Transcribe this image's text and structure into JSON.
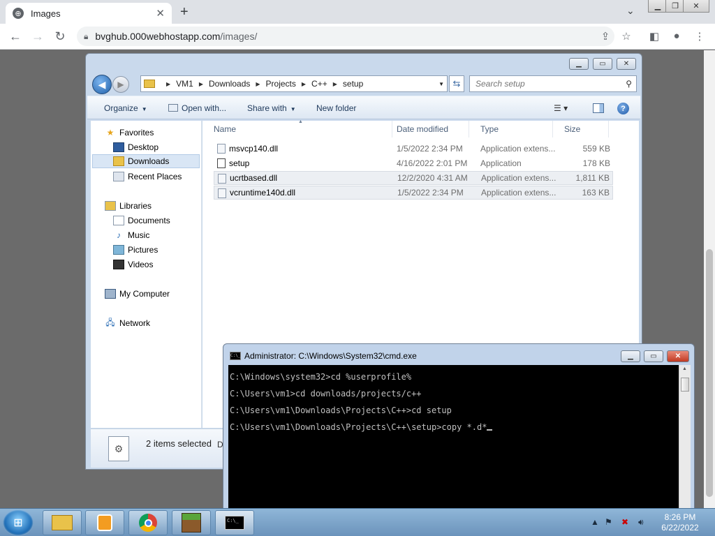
{
  "browser": {
    "tab_title": "Images",
    "url_host": "bvghub.000webhostapp.com",
    "url_path": "/images/"
  },
  "explorer": {
    "breadcrumbs": [
      "VM1",
      "Downloads",
      "Projects",
      "C++",
      "setup"
    ],
    "search_placeholder": "Search setup",
    "commands": {
      "organize": "Organize",
      "open_with": "Open with...",
      "share_with": "Share with",
      "new_folder": "New folder"
    },
    "nav": {
      "favorites": "Favorites",
      "desktop": "Desktop",
      "downloads": "Downloads",
      "recent_places": "Recent Places",
      "libraries": "Libraries",
      "documents": "Documents",
      "music": "Music",
      "pictures": "Pictures",
      "videos": "Videos",
      "my_computer": "My Computer",
      "network": "Network"
    },
    "columns": {
      "name": "Name",
      "date": "Date modified",
      "type": "Type",
      "size": "Size"
    },
    "files": [
      {
        "name": "msvcp140.dll",
        "date": "1/5/2022 2:34 PM",
        "type": "Application extens...",
        "size": "559 KB",
        "selected": false
      },
      {
        "name": "setup",
        "date": "4/16/2022 2:01 PM",
        "type": "Application",
        "size": "178 KB",
        "selected": false
      },
      {
        "name": "ucrtbased.dll",
        "date": "12/2/2020 4:31 AM",
        "type": "Application extens...",
        "size": "1,811 KB",
        "selected": true
      },
      {
        "name": "vcruntime140d.dll",
        "date": "1/5/2022 2:34 PM",
        "type": "Application extens...",
        "size": "163 KB",
        "selected": true
      }
    ],
    "status_text": "2 items selected",
    "status_extra": "D"
  },
  "cmd": {
    "title": "Administrator: C:\\Windows\\System32\\cmd.exe",
    "lines": [
      "C:\\Windows\\system32>cd %userprofile%",
      "C:\\Users\\vm1>cd downloads/projects/c++",
      "C:\\Users\\vm1\\Downloads\\Projects\\C++>cd setup",
      "C:\\Users\\vm1\\Downloads\\Projects\\C++\\setup>copy *.d*"
    ]
  },
  "taskbar": {
    "time": "8:26 PM",
    "date": "6/22/2022"
  }
}
